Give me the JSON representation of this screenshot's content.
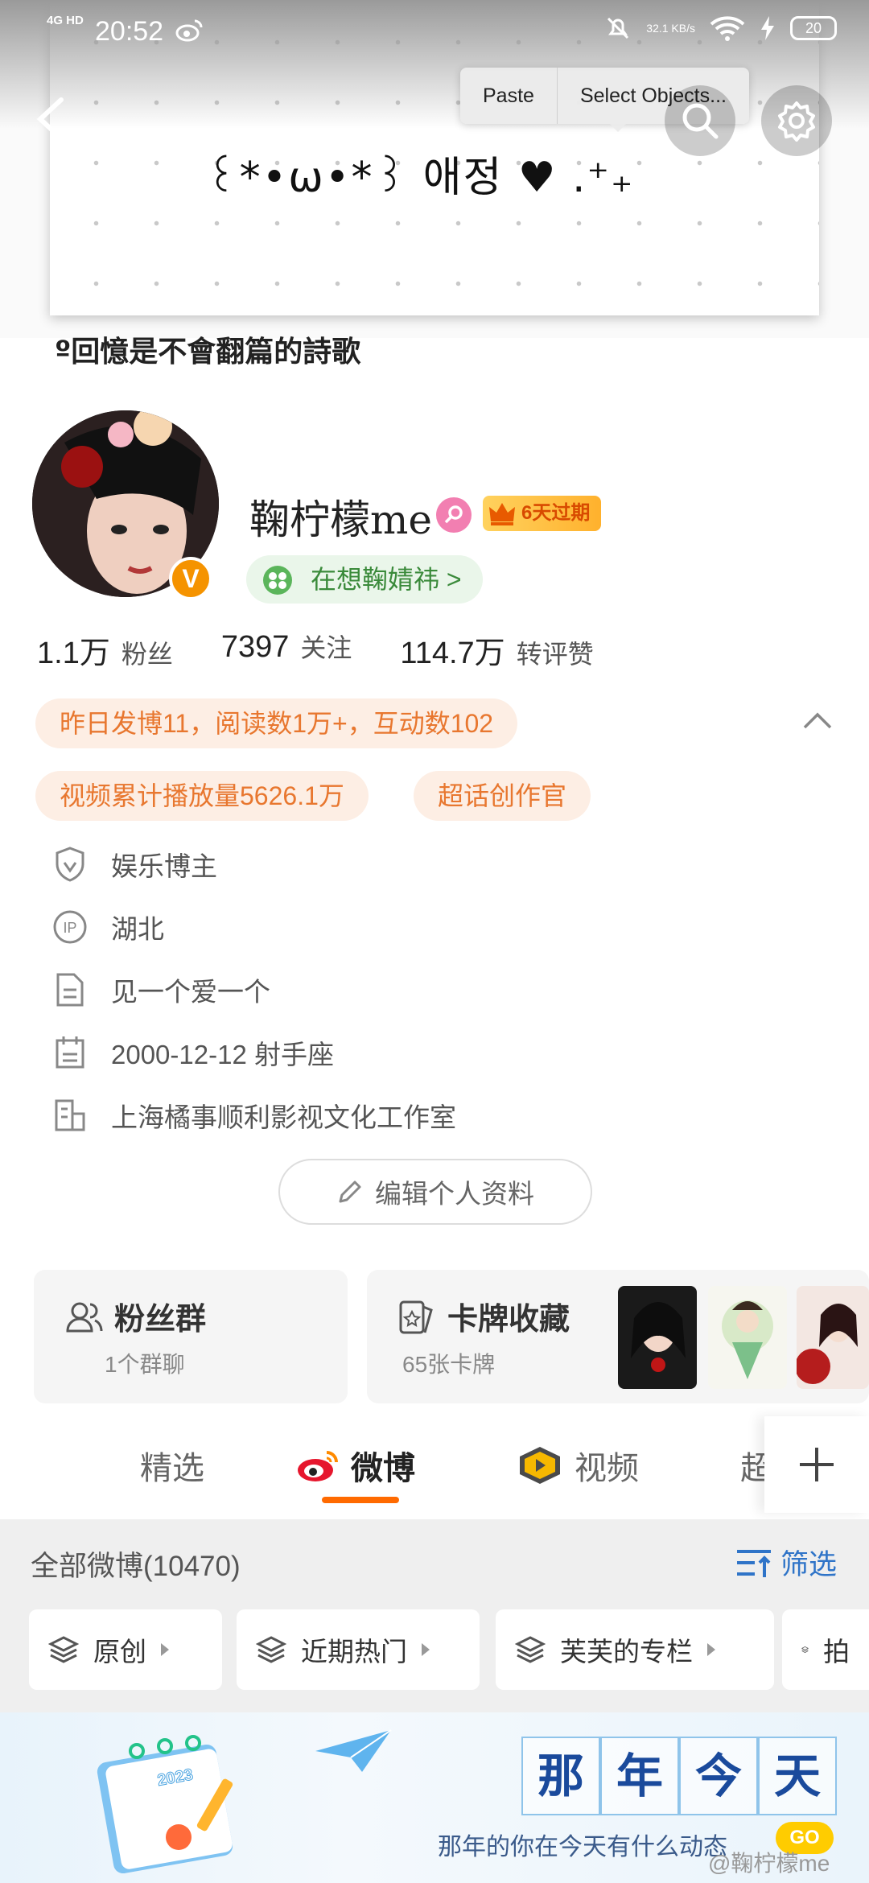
{
  "status_bar": {
    "network": "4G HD",
    "time": "20:52",
    "speed": "32.1 KB/s",
    "battery": "20"
  },
  "context_menu": {
    "paste": "Paste",
    "select_objects": "Select Objects..."
  },
  "cover": {
    "text": "꒰*•ω•*꒱ 애정 ♥ .⁺₊"
  },
  "signature": "º回憶是不會翻篇的詩歌",
  "profile": {
    "nickname": "鞠柠檬me",
    "vip_label": "6天过期",
    "verified_badge": "V",
    "mood": "在想鞠婧祎 >"
  },
  "stats": [
    {
      "value": "1.1万",
      "label": "粉丝"
    },
    {
      "value": "7397",
      "label": "关注"
    },
    {
      "value": "114.7万",
      "label": "转评赞"
    }
  ],
  "pills": {
    "yesterday": "昨日发博11，阅读数1万+，互动数102",
    "video": "视频累计播放量5626.1万",
    "topic": "超话创作官"
  },
  "info": {
    "category": "娱乐博主",
    "ip": "湖北",
    "bio": "见一个爱一个",
    "birthday": "2000-12-12 射手座",
    "company": "上海橘事顺利影视文化工作室"
  },
  "edit_button": "编辑个人资料",
  "cards": {
    "fan_group_title": "粉丝群",
    "fan_group_sub": "1个群聊",
    "cards_title": "卡牌收藏",
    "cards_sub": "65张卡牌"
  },
  "tabs": [
    "精选",
    "微博",
    "视频",
    "超"
  ],
  "feed": {
    "title": "全部微博(10470)",
    "filter": "筛选",
    "chips": [
      "原创",
      "近期热门",
      "芙芙的专栏",
      "拍"
    ]
  },
  "banner": {
    "cells": [
      "那",
      "年",
      "今",
      "天"
    ],
    "subtitle": "那年的你在今天有什么动态",
    "go": "GO",
    "calendar_year": "2023",
    "watermark": "@鞠柠檬me"
  },
  "colors": {
    "accent": "#ff6a00",
    "pill_text": "#e8772f",
    "filter_blue": "#2f74c8"
  }
}
